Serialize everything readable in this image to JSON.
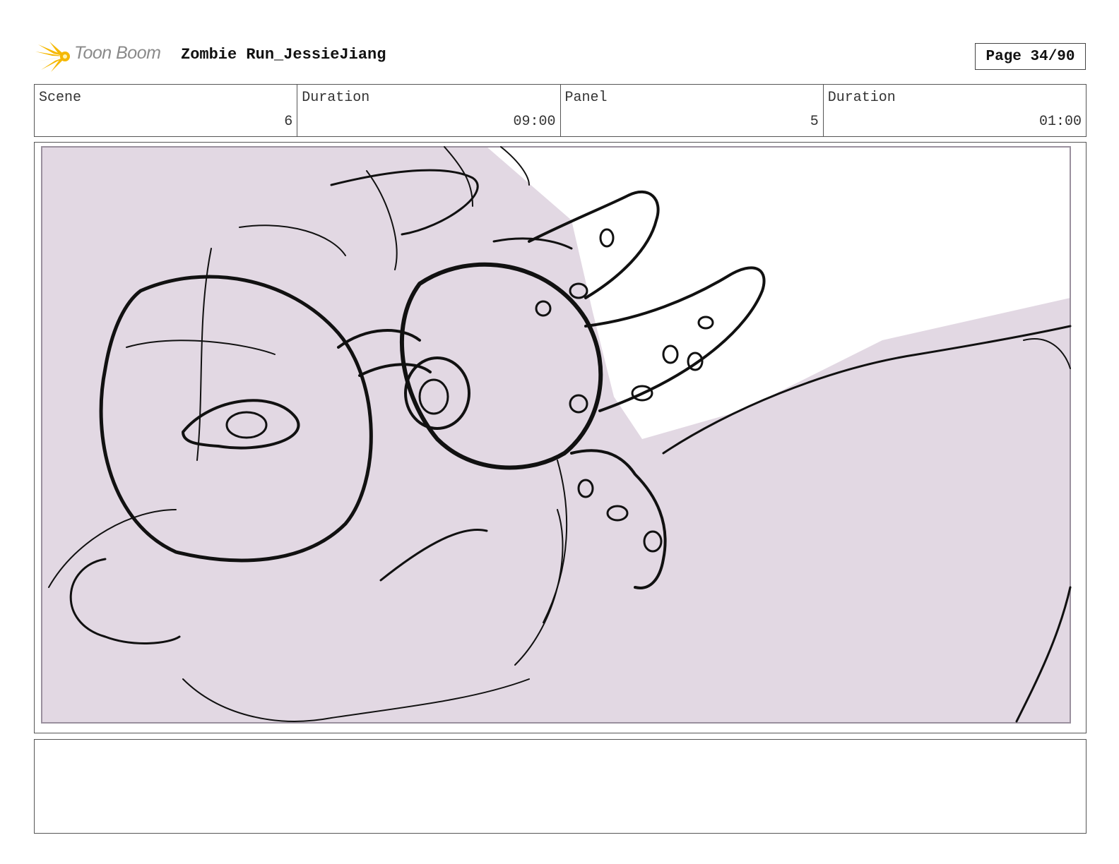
{
  "header": {
    "logo_text": "Toon Boom",
    "project_title": "Zombie Run_JessieJiang",
    "page_label": "Page 34/90"
  },
  "info": {
    "scene_label": "Scene",
    "scene_value": "6",
    "scene_duration_label": "Duration",
    "scene_duration_value": "09:00",
    "panel_label": "Panel",
    "panel_value": "5",
    "panel_duration_label": "Duration",
    "panel_duration_value": "01:00"
  },
  "panel": {
    "background_color": "#e2d8e3",
    "line_color": "#111111"
  },
  "notes": {
    "text": ""
  },
  "colors": {
    "logo_star": "#f5b800",
    "logo_text": "#8a8a8a",
    "border": "#555555"
  }
}
